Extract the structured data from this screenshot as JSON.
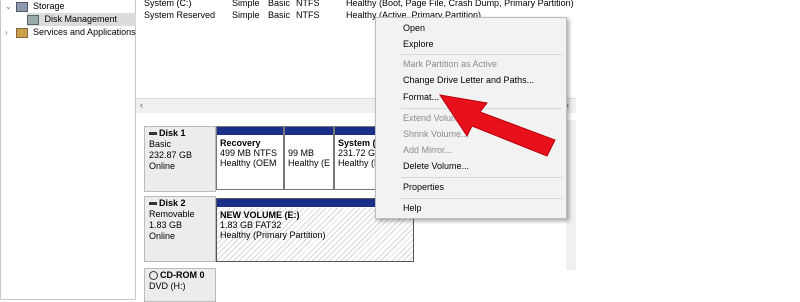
{
  "tree": {
    "storage": "Storage",
    "disk_management": "Disk Management",
    "services": "Services and Applications"
  },
  "volumes": [
    {
      "name": "System (C:)",
      "layout": "Simple",
      "type": "Basic",
      "fs": "NTFS",
      "status": "Healthy (Boot, Page File, Crash Dump, Primary Partition)"
    },
    {
      "name": "System Reserved",
      "layout": "Simple",
      "type": "Basic",
      "fs": "NTFS",
      "status": "Healthy (Active, Primary Partition)"
    }
  ],
  "disks": [
    {
      "title": "Disk 1",
      "type": "Basic",
      "size": "232.87 GB",
      "state": "Online",
      "partitions": [
        {
          "name": "Recovery",
          "size": "499 MB NTFS",
          "status": "Healthy (OEM"
        },
        {
          "name": "",
          "size": "99 MB",
          "status": "Healthy (E"
        },
        {
          "name": "System  (C",
          "size": "231.72 GB",
          "status": "Healthy (B"
        }
      ]
    },
    {
      "title": "Disk 2",
      "type": "Removable",
      "size": "1.83 GB",
      "state": "Online",
      "partitions": [
        {
          "name": "NEW VOLUME  (E:)",
          "size": "1.83 GB FAT32",
          "status": "Healthy (Primary Partition)"
        }
      ]
    },
    {
      "title": "CD-ROM 0",
      "type": "DVD (H:)",
      "size": "",
      "state": ""
    }
  ],
  "context_menu": {
    "open": "Open",
    "explore": "Explore",
    "mark_active": "Mark Partition as Active",
    "change_letter": "Change Drive Letter and Paths...",
    "format": "Format...",
    "extend": "Extend Volume...",
    "shrink": "Shrink Volume...",
    "add_mirror": "Add Mirror...",
    "delete": "Delete Volume...",
    "properties": "Properties",
    "help": "Help"
  },
  "colors": {
    "partition_bar": "#1a2f8a",
    "arrow": "#e8101b",
    "menu_bg": "#f2f2f2"
  }
}
